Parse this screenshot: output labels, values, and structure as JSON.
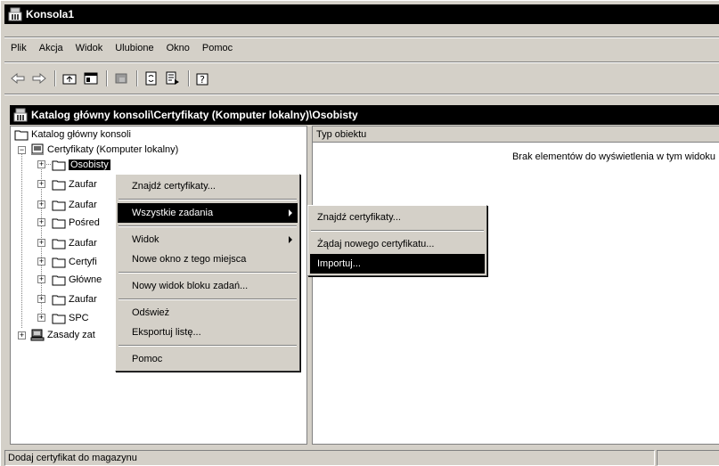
{
  "window": {
    "title": "Konsola1"
  },
  "menubar": [
    "Plik",
    "Akcja",
    "Widok",
    "Ulubione",
    "Okno",
    "Pomoc"
  ],
  "toolbar_icons": [
    "back-arrow-icon",
    "forward-arrow-icon",
    "up-folder-icon",
    "show-hide-tree-icon",
    "delete-icon",
    "refresh-icon",
    "export-list-icon",
    "help-icon"
  ],
  "inner_window": {
    "title": "Katalog główny konsoli\\Certyfikaty (Komputer lokalny)\\Osobisty"
  },
  "tree": {
    "root": "Katalog główny konsoli",
    "certs": "Certyfikaty (Komputer lokalny)",
    "children": [
      "Osobisty",
      "Zaufar",
      "Zaufar",
      "Pośred",
      "Zaufar",
      "Certyfi",
      "Główne",
      "Zaufar",
      "SPC"
    ],
    "policy": "Zasady zat"
  },
  "list": {
    "column": "Typ obiektu",
    "empty_text": "Brak elementów do wyświetlenia w tym widoku"
  },
  "context_menu": {
    "items": [
      "Znajdź certyfikaty...",
      "Wszystkie zadania",
      "Widok",
      "Nowe okno z tego miejsca",
      "Nowy widok bloku zadań...",
      "Odśwież",
      "Eksportuj listę...",
      "Pomoc"
    ]
  },
  "submenu": {
    "items": [
      "Znajdź certyfikaty...",
      "Żądaj nowego certyfikatu...",
      "Importuj..."
    ]
  },
  "status": {
    "text": "Dodaj certyfikat do magazynu"
  }
}
